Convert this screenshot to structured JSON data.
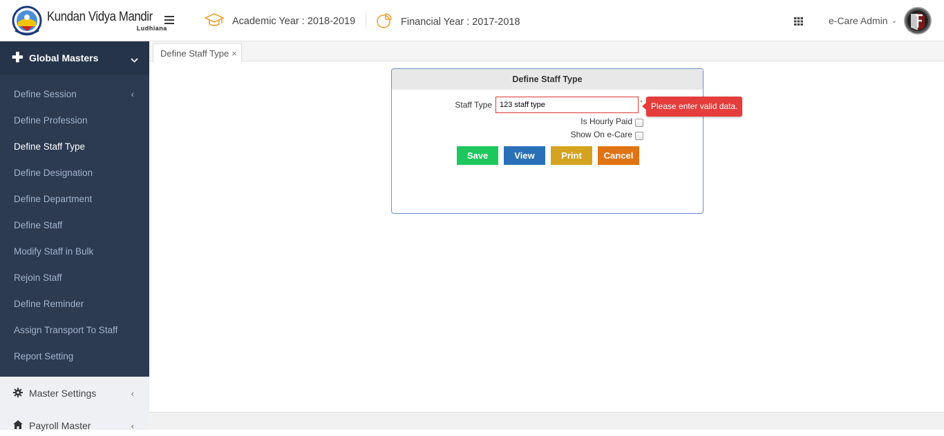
{
  "header": {
    "brand_name": "Kundan Vidya Mandir",
    "brand_sub": "Ludhiana",
    "academic_year": "Academic Year : 2018-2019",
    "financial_year": "Financial Year : 2017-2018",
    "user_name": "e-Care Admin",
    "accent": "#f0a030"
  },
  "sidebar": {
    "group_label": "Global Masters",
    "items": [
      {
        "label": "Define Session"
      },
      {
        "label": "Define Profession"
      },
      {
        "label": "Define Staff Type"
      },
      {
        "label": "Define Designation"
      },
      {
        "label": "Define Department"
      },
      {
        "label": "Define Staff"
      },
      {
        "label": "Modify Staff in Bulk"
      },
      {
        "label": "Rejoin Staff"
      },
      {
        "label": "Define Reminder"
      },
      {
        "label": "Assign Transport To Staff"
      },
      {
        "label": "Report Setting"
      }
    ],
    "bottom_items": [
      {
        "label": "Master Settings",
        "icon": "gear-icon"
      },
      {
        "label": "Payroll Master",
        "icon": "home-icon"
      }
    ],
    "bg": "#2c3b52"
  },
  "tabs": [
    {
      "label": "Define Staff Type",
      "close": "×"
    }
  ],
  "form": {
    "title": "Define Staff Type",
    "staff_type_label": "Staff Type",
    "staff_type_value": "123 staff type",
    "required_mark": "*",
    "hourly_label": "Is Hourly Paid",
    "ecare_label": "Show On e-Care",
    "error_text": "Please enter valid data.",
    "buttons": {
      "save": "Save",
      "view": "View",
      "print": "Print",
      "cancel": "Cancel"
    },
    "colors": {
      "save": "#1ec75e",
      "view": "#2a70b8",
      "print": "#d4a320",
      "cancel": "#e07314",
      "error": "#e53c3c"
    }
  }
}
